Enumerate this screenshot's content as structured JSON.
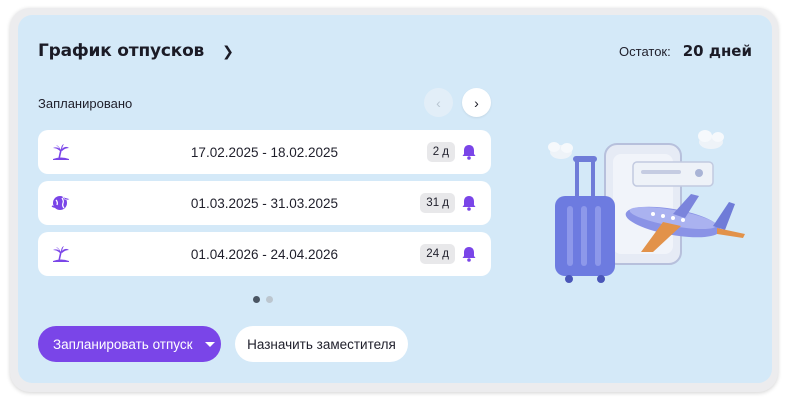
{
  "header": {
    "title": "График отпусков",
    "balance_label": "Остаток:",
    "balance_value": "20 дней"
  },
  "section": {
    "label": "Запланировано"
  },
  "vacations": [
    {
      "dates": "17.02.2025 - 18.02.2025",
      "days": "2 д",
      "icon": "palm-island-icon"
    },
    {
      "dates": "01.03.2025 - 31.03.2025",
      "days": "31 д",
      "icon": "globe-plane-icon"
    },
    {
      "dates": "01.04.2026 - 24.04.2026",
      "days": "24 д",
      "icon": "palm-island-icon"
    }
  ],
  "pagination": {
    "pages": 2,
    "current": 1
  },
  "actions": {
    "plan_vacation": "Запланировать отпуск",
    "assign_deputy": "Назначить заместителя"
  },
  "colors": {
    "accent": "#7a45e8",
    "card_background": "#d4e9f8",
    "item_background": "#ffffff",
    "badge_background": "#e8e8ea"
  }
}
